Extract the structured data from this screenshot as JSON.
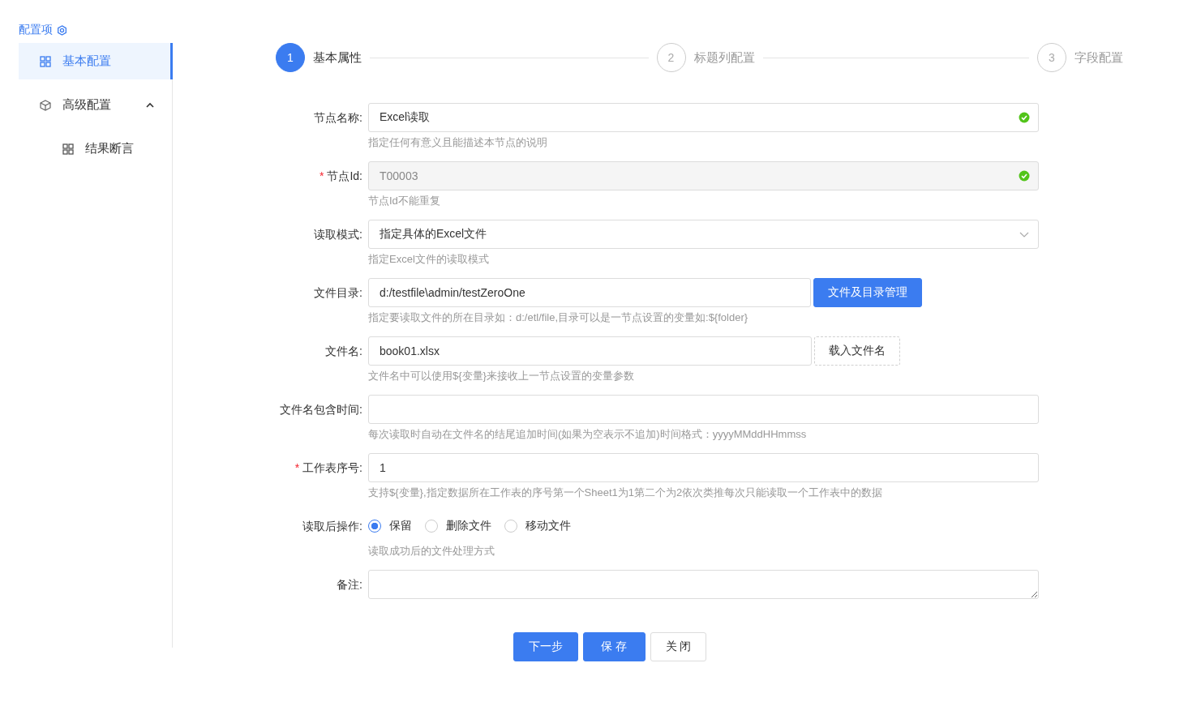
{
  "sidebar": {
    "title": "配置项",
    "items": [
      {
        "label": "基本配置",
        "selected": true
      },
      {
        "label": "高级配置",
        "selected": false,
        "expanded": true,
        "children": [
          {
            "label": "结果断言",
            "selected": false
          }
        ]
      }
    ]
  },
  "steps": [
    {
      "number": "1",
      "label": "基本属性",
      "active": true
    },
    {
      "number": "2",
      "label": "标题列配置",
      "active": false
    },
    {
      "number": "3",
      "label": "字段配置",
      "active": false
    }
  ],
  "fields": [
    {
      "kind": "input",
      "label": "节点名称:",
      "value": "Excel读取",
      "valid": true,
      "help": "指定任何有意义且能描述本节点的说明"
    },
    {
      "kind": "input",
      "required_mark": "*",
      "label": "节点Id:",
      "value": "T00003",
      "valid": true,
      "disabled": true,
      "help": "节点Id不能重复"
    },
    {
      "kind": "select",
      "label": "读取模式:",
      "value": "指定具体的Excel文件",
      "help": "指定Excel文件的读取模式"
    },
    {
      "kind": "input",
      "label": "文件目录:",
      "value": "d:/testfile\\admin/testZeroOne",
      "help": "指定要读取文件的所在目录如：d:/etl/file,目录可以是一节点设置的变量如:${folder}",
      "button": {
        "label": "文件及目录管理",
        "primary": true
      }
    },
    {
      "kind": "input",
      "label": "文件名:",
      "value": "book01.xlsx",
      "help": "文件名中可以使用${变量}来接收上一节点设置的变量参数",
      "button": {
        "label": "载入文件名",
        "primary": false
      }
    },
    {
      "kind": "input",
      "label": "文件名包含时间:",
      "help": "每次读取时自动在文件名的结尾追加时间(如果为空表示不追加)时间格式：yyyyMMddHHmmss"
    },
    {
      "kind": "input",
      "required_mark": "*",
      "label": "工作表序号:",
      "value": "1",
      "help": "支持${变量},指定数据所在工作表的序号第一个Sheet1为1第二个为2依次类推每次只能读取一个工作表中的数据"
    },
    {
      "kind": "radio",
      "label": "读取后操作:",
      "options": [
        {
          "label": "保留",
          "selected": true
        },
        {
          "label": "删除文件",
          "selected": false
        },
        {
          "label": "移动文件",
          "selected": false
        }
      ],
      "help": "读取成功后的文件处理方式"
    },
    {
      "kind": "textarea",
      "label": "备注:"
    }
  ],
  "buttons": [
    {
      "label": "下一步",
      "primary": true
    },
    {
      "label": "保 存",
      "primary": true
    },
    {
      "label": "关 闭",
      "primary": false
    }
  ]
}
